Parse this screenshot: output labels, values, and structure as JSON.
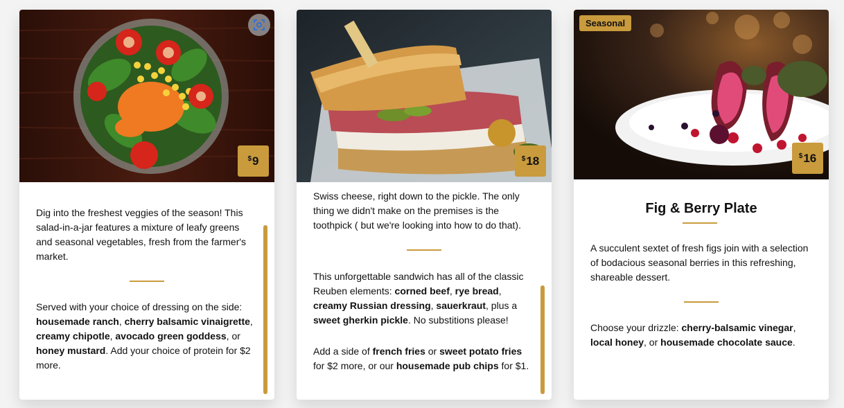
{
  "cards": [
    {
      "price": "9",
      "intro": "Dig into the freshest veggies of the season! This salad-in-a-jar features a mixture of leafy greens and seasonal vegetables, fresh from the farmer's market.",
      "served_prefix": "Served with your choice of dressing on the side: ",
      "dressings": [
        "housemade ranch",
        "cherry balsamic vinaigrette",
        "creamy chipotle",
        "avocado green goddess",
        "honey mustard"
      ],
      "sep1": ", ",
      "sep2": ", ",
      "sep3": ", ",
      "sep4": ", or ",
      "served_suffix": ". Add your choice of protein for $2 more."
    },
    {
      "price": "18",
      "partial": "Swiss cheese, right down to the pickle. The only thing we didn't make on the premises is the toothpick ( but we're looking into how to do that).",
      "para2_prefix": "This unforgettable sandwich has all of the classic Reuben elements: ",
      "elements": [
        "corned beef",
        "rye bread",
        "creamy Russian dressing",
        "sauerkraut",
        "sweet gherkin pickle"
      ],
      "sep1": ", ",
      "sep2": ", ",
      "sep3": ", ",
      "sep4": ", plus a ",
      "para2_suffix": ". No substitions please!",
      "side_prefix": "Add a side of ",
      "side1": "french fries",
      "side_or": " or ",
      "side2": "sweet potato fries",
      "side_mid": " for $2 more, or our ",
      "side3": "housemade pub chips",
      "side_suffix": " for $1."
    },
    {
      "price": "16",
      "badge": "Seasonal",
      "title": "Fig & Berry Plate",
      "desc": "A succulent sextet of fresh figs join with a selection of bodacious seasonal berries in this refreshing, shareable dessert.",
      "drizzle_prefix": "Choose your drizzle: ",
      "drizzles": [
        "cherry-balsamic vinegar",
        "local honey",
        "housemade chocolate sauce"
      ],
      "sep1": ", ",
      "sep2": ", or ",
      "drizzle_suffix": "."
    }
  ],
  "currency": "$",
  "icons": {
    "scan": "visual-search-icon"
  },
  "colors": {
    "accent": "#c99b3d",
    "card": "#ffffff",
    "background": "#f3f3f3"
  }
}
